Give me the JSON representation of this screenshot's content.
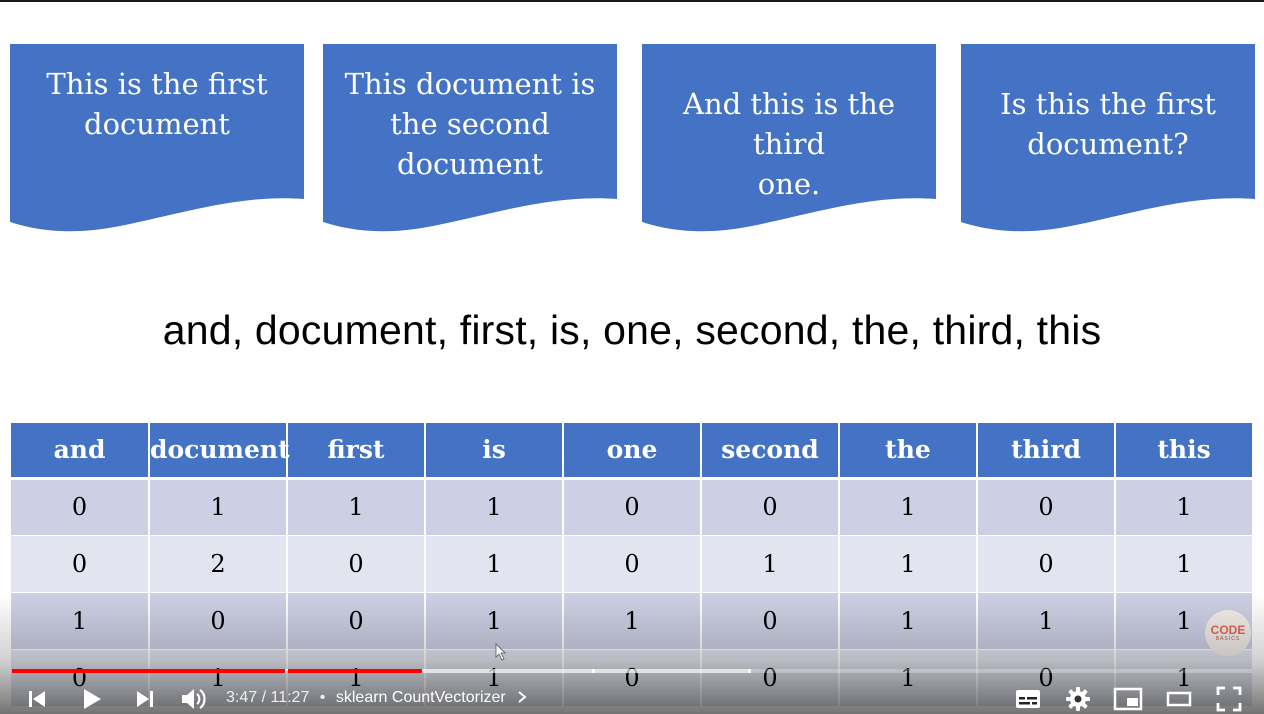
{
  "documents": [
    {
      "text": "This is the first\ndocument"
    },
    {
      "text": "This document is\nthe second\ndocument"
    },
    {
      "text": "And this is the third\none."
    },
    {
      "text": "Is this the first\ndocument?"
    }
  ],
  "vocabulary_line": "and, document, first, is, one, second, the, third, this",
  "table": {
    "headers": [
      "and",
      "document",
      "first",
      "is",
      "one",
      "second",
      "the",
      "third",
      "this"
    ],
    "rows": [
      [
        "0",
        "1",
        "1",
        "1",
        "0",
        "0",
        "1",
        "0",
        "1"
      ],
      [
        "0",
        "2",
        "0",
        "1",
        "0",
        "1",
        "1",
        "0",
        "1"
      ],
      [
        "1",
        "0",
        "0",
        "1",
        "1",
        "0",
        "1",
        "1",
        "1"
      ],
      [
        "0",
        "1",
        "1",
        "1",
        "0",
        "0",
        "1",
        "0",
        "1"
      ]
    ]
  },
  "watermark": {
    "line1": "CODE",
    "line2": "BASICS"
  },
  "player": {
    "current_time": "3:47",
    "duration": "11:27",
    "separator": "•",
    "chapter_title": "sklearn CountVectorizer",
    "progress_fraction": 0.331,
    "buffered_fraction": 0.594,
    "accent_color": "#ff0000",
    "icons": [
      "previous-icon",
      "play-icon",
      "next-icon",
      "volume-icon",
      "chevron-right-icon",
      "subtitles-icon",
      "gear-icon",
      "miniplayer-icon",
      "theater-icon",
      "fullscreen-icon"
    ]
  },
  "colors": {
    "doc_fill": "#4472c4",
    "header_fill": "#4472c4"
  }
}
